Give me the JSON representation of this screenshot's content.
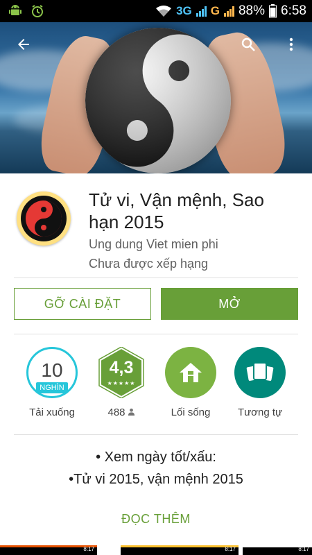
{
  "status_bar": {
    "network1": "3G",
    "network2": "G",
    "battery": "88%",
    "time": "6:58"
  },
  "banner": {
    "icons": [
      "back-arrow-icon",
      "search-icon",
      "more-vert-icon"
    ]
  },
  "app": {
    "title": "Tử vi, Vận mệnh, Sao hạn 2015",
    "developer": "Ung dung Viet mien phi",
    "rating_status": "Chưa được xếp hạng"
  },
  "buttons": {
    "uninstall": "GỠ CÀI ĐẶT",
    "open": "MỞ"
  },
  "stats": {
    "downloads_value": "10",
    "downloads_unit": "NGHÌN",
    "downloads_label": "Tải xuống",
    "rating_value": "4,3",
    "rating_stars": "★★★★★",
    "rating_count": "488",
    "category_label": "Lối sống",
    "similar_label": "Tương tự"
  },
  "description": {
    "line1": "• Xem ngày tốt/xấu:",
    "line2": "•Tử vi 2015, vận mệnh 2015",
    "read_more": "ĐỌC THÊM"
  },
  "thumbnails": {
    "time": "8:17"
  },
  "colors": {
    "accent_green": "#689f38",
    "download_cyan": "#26c6da",
    "category_green": "#7cb342",
    "similar_teal": "#00897b"
  }
}
